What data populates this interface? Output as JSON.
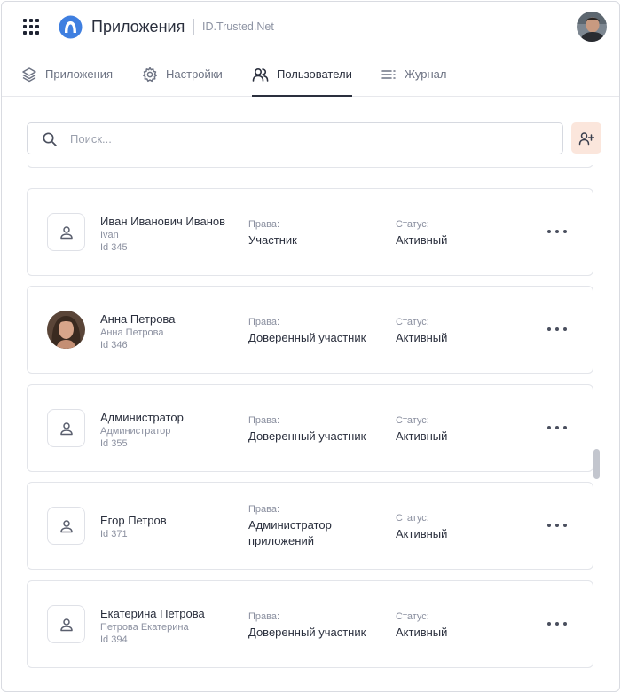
{
  "header": {
    "title": "Приложения",
    "subtitle": "ID.Trusted.Net"
  },
  "tabs": [
    {
      "label": "Приложения",
      "icon": "layers-icon"
    },
    {
      "label": "Настройки",
      "icon": "gear-icon"
    },
    {
      "label": "Пользователи",
      "icon": "users-icon",
      "active": true
    },
    {
      "label": "Журнал",
      "icon": "list-icon"
    }
  ],
  "search": {
    "placeholder": "Поиск...",
    "value": ""
  },
  "columns": {
    "rights_label": "Права:",
    "status_label": "Статус:"
  },
  "users": [
    {
      "name": "Иван Иванович Иванов",
      "login": "Ivan",
      "id": "Id 345",
      "rights": "Участник",
      "status": "Активный",
      "avatar": "person-icon"
    },
    {
      "name": "Анна Петрова",
      "login": "Анна Петрова",
      "id": "Id 346",
      "rights": "Доверенный участник",
      "status": "Активный",
      "avatar": "user-photo"
    },
    {
      "name": "Администратор",
      "login": "Администратор",
      "id": "Id 355",
      "rights": "Доверенный участник",
      "status": "Активный",
      "avatar": "person-icon"
    },
    {
      "name": "Егор Петров",
      "login": "",
      "id": "Id 371",
      "rights": "Администратор приложений",
      "status": "Активный",
      "avatar": "person-icon"
    },
    {
      "name": "Екатерина Петрова",
      "login": "Петрова Екатерина",
      "id": "Id 394",
      "rights": "Доверенный участник",
      "status": "Активный",
      "avatar": "person-icon"
    }
  ],
  "colors": {
    "accent": "#2a2f3d",
    "add_button_bg": "#fbe6dc",
    "logo_blue": "#3f7fe0",
    "border": "#e3e5ea"
  }
}
